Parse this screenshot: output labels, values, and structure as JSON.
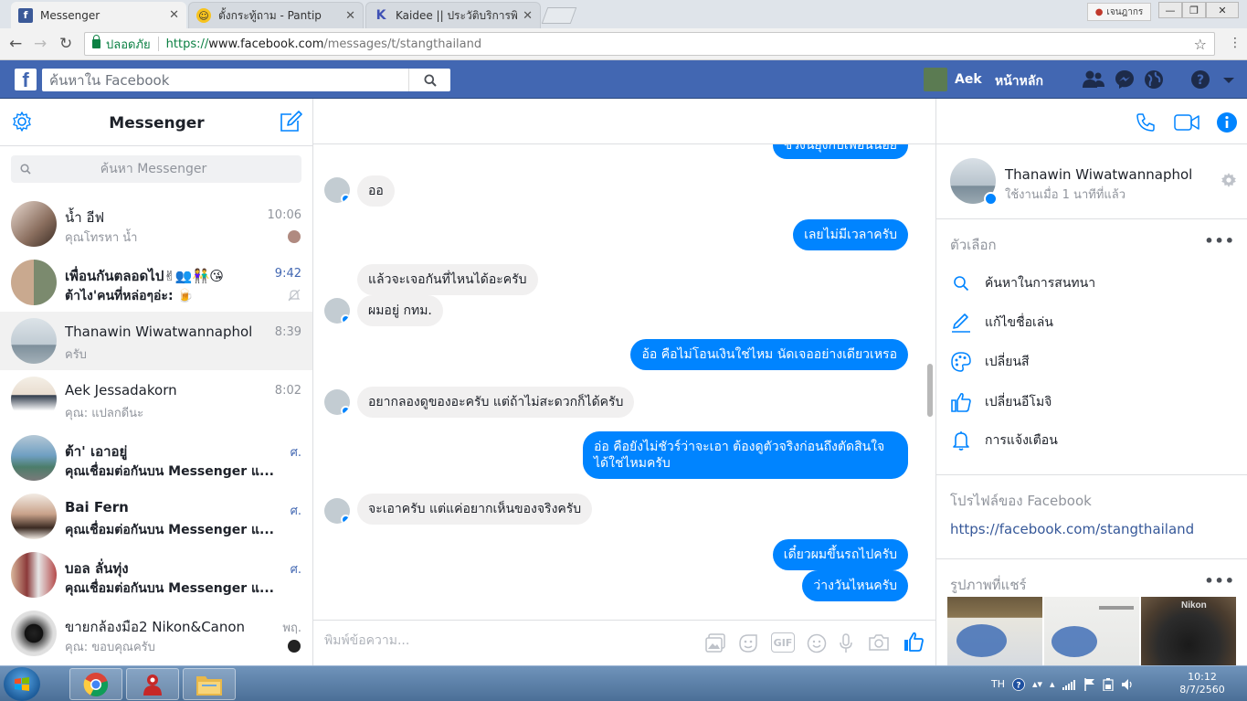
{
  "browser": {
    "tabs": [
      {
        "title": "Messenger",
        "icon": "facebook-icon"
      },
      {
        "title": "ตั้งกระทู้ถาม - Pantip",
        "icon": "pantip-icon"
      },
      {
        "title": "Kaidee || ประวัติบริการพิเศษ",
        "icon": "kaidee-icon"
      }
    ],
    "window_user": "เจนฎากร",
    "secure_label": "ปลอดภัย",
    "url_proto": "https://",
    "url_host": "www.facebook.com",
    "url_path": "/messages/t/stangthailand"
  },
  "fb": {
    "logo": "f",
    "search_placeholder": "ค้นหาใน Facebook",
    "user_name": "Aek",
    "home_label": "หน้าหลัก"
  },
  "sidebar": {
    "title": "Messenger",
    "search_placeholder": "ค้นหา Messenger",
    "conversations": [
      {
        "name": "น้ำ อีฟ",
        "snippet": "คุณโทรหา น้ำ",
        "time": "10:06",
        "unread": false
      },
      {
        "name": "เพื่อนกันตลอดไป✌👥👫😘",
        "snippet": "ต้าไง'คนที่หล่อๆอ่ะ: 🍺",
        "time": "9:42",
        "unread": true
      },
      {
        "name": "Thanawin Wiwatwannaphol",
        "snippet": "ครับ",
        "time": "8:39",
        "unread": false
      },
      {
        "name": "Aek Jessadakorn",
        "snippet": "คุณ: แปลกดีนะ",
        "time": "8:02",
        "unread": false
      },
      {
        "name": "ต้า' เอาอยู่",
        "snippet": "คุณเชื่อมต่อกันบน Messenger แ...",
        "time": "ศ.",
        "unread": true
      },
      {
        "name": "Bai Fern",
        "snippet": "คุณเชื่อมต่อกันบน Messenger แ...",
        "time": "ศ.",
        "unread": true
      },
      {
        "name": "บอล ลั่นทุ่ง",
        "snippet": "คุณเชื่อมต่อกันบน Messenger แ...",
        "time": "ศ.",
        "unread": true
      },
      {
        "name": "ขายกล้องมือ2 Nikon&Canon",
        "snippet": "คุณ: ขอบคุณครับ",
        "time": "พฤ.",
        "unread": false
      }
    ]
  },
  "chat": {
    "contact_name": "Thanawin Wiwatwannaphol",
    "status": "ใช้งานเมื่อ 1 นาทีที่แล้ว",
    "top_partial": "ช่วงนี้ยุ่งกับเพื่อนน้อย",
    "messages": [
      {
        "dir": "in",
        "text": "ออ"
      },
      {
        "dir": "out",
        "text": "เลยไม่มีเวลาครับ"
      },
      {
        "dir": "in",
        "text": "แล้วจะเจอกันที่ไหนได้อะครับ"
      },
      {
        "dir": "in",
        "text": "ผมอยู่ กทม."
      },
      {
        "dir": "out",
        "text": "อ้อ คือไม่โอนเงินใช่ไหม นัดเจออย่างเดียวเหรอ"
      },
      {
        "dir": "in",
        "text": "อยากลองดูของอะครับ  แต่ถ้าไม่สะดวกก็ได้ครับ"
      },
      {
        "dir": "out",
        "text": "อ่อ คือยังไม่ชัวร์ว่าจะเอา ต้องดูตัวจริงก่อนถึงตัดสินใจได้ใช่ไหมครับ"
      },
      {
        "dir": "in",
        "text": "จะเอาครับ  แต่แค่อยากเห็นของจริงครับ"
      },
      {
        "dir": "out",
        "text": "เดี๋ยวผมขึ้นรถไปครับ"
      },
      {
        "dir": "out",
        "text": "ว่างวันไหนครับ"
      }
    ],
    "composer_placeholder": "พิมพ์ข้อความ...",
    "gif_label": "GIF"
  },
  "info": {
    "name": "Thanawin Wiwatwannaphol",
    "status": "ใช้งานเมื่อ 1 นาทีที่แล้ว",
    "options_title": "ตัวเลือก",
    "options": [
      {
        "label": "ค้นหาในการสนทนา",
        "icon": "search-icon"
      },
      {
        "label": "แก้ไขชื่อเล่น",
        "icon": "pencil-icon"
      },
      {
        "label": "เปลี่ยนสี",
        "icon": "palette-icon"
      },
      {
        "label": "เปลี่ยนอีโมจิ",
        "icon": "thumbs-up-icon"
      },
      {
        "label": "การแจ้งเตือน",
        "icon": "bell-icon"
      }
    ],
    "profile_title": "โปรไฟล์ของ Facebook",
    "profile_link": "https://facebook.com/stangthailand",
    "photos_title": "รูปภาพที่แชร์",
    "photo_brand": "Nikon"
  },
  "taskbar": {
    "lang": "TH",
    "time": "10:12",
    "date": "8/7/2560"
  },
  "colors": {
    "fb_blue": "#4267b2",
    "messenger_blue": "#0084ff",
    "link": "#365899"
  }
}
